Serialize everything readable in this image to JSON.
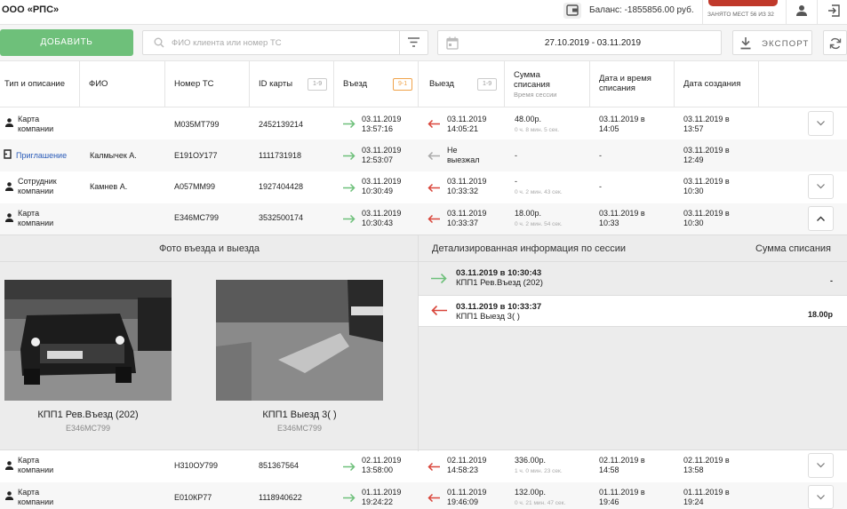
{
  "header": {
    "company": "ООО «РПС»",
    "balance": "Баланс: -1855856.00 руб.",
    "places": "ЗАНЯТО МЕСТ 56 ИЗ 32"
  },
  "toolbar": {
    "add_label": "ДОБАВИТЬ",
    "search_placeholder": "ФИО клиента или номер ТС",
    "date_range": "27.10.2019 - 03.11.2019",
    "export_label": "ЭКСПОРТ"
  },
  "columns": {
    "type": "Тип и описание",
    "name": "ФИО",
    "plate": "Номер ТС",
    "card": "ID карты",
    "card_sort": "1-9",
    "entry": "Въезд",
    "entry_sort": "9-1",
    "exit": "Выезд",
    "exit_sort": "1-9",
    "sum_l1": "Сумма",
    "sum_l2": "списания",
    "sum_sub": "Время сессии",
    "charged_l1": "Дата и время",
    "charged_l2": "списания",
    "created": "Дата создания"
  },
  "rows": [
    {
      "type_l1": "Карта",
      "type_l2": "компании",
      "name": "",
      "plate": "М035МТ799",
      "card": "2452139214",
      "entry_d": "03.11.2019",
      "entry_t": "13:57:16",
      "exit_d": "03.11.2019",
      "exit_t": "14:05:21",
      "sum": "48.00р.",
      "dur": "0 ч. 8 мин. 5 сек.",
      "charged_d": "03.11.2019 в",
      "charged_t": "14:05",
      "created_d": "03.11.2019 в",
      "created_t": "13:57"
    },
    {
      "type_l1": "Приглашение",
      "type_l2": "",
      "name": "Калмычек А.",
      "plate": "Е191ОУ177",
      "card": "1111731918",
      "entry_d": "03.11.2019",
      "entry_t": "12:53:07",
      "exit_d": "Не",
      "exit_t": "выезжал",
      "sum": "-",
      "dur": "",
      "charged_d": "-",
      "charged_t": "",
      "created_d": "03.11.2019 в",
      "created_t": "12:49"
    },
    {
      "type_l1": "Сотрудник",
      "type_l2": "компании",
      "name": "Камнев А.",
      "plate": "А057ММ99",
      "card": "1927404428",
      "entry_d": "03.11.2019",
      "entry_t": "10:30:49",
      "exit_d": "03.11.2019",
      "exit_t": "10:33:32",
      "sum": "-",
      "dur": "0 ч. 2 мин. 43 сек.",
      "charged_d": "-",
      "charged_t": "",
      "created_d": "03.11.2019 в",
      "created_t": "10:30"
    },
    {
      "type_l1": "Карта",
      "type_l2": "компании",
      "name": "",
      "plate": "Е346МС799",
      "card": "3532500174",
      "entry_d": "03.11.2019",
      "entry_t": "10:30:43",
      "exit_d": "03.11.2019",
      "exit_t": "10:33:37",
      "sum": "18.00р.",
      "dur": "0 ч. 2 мин. 54 сек.",
      "charged_d": "03.11.2019 в",
      "charged_t": "10:33",
      "created_d": "03.11.2019 в",
      "created_t": "10:30"
    },
    {
      "type_l1": "Карта",
      "type_l2": "компании",
      "name": "",
      "plate": "Н310ОУ799",
      "card": "851367564",
      "entry_d": "02.11.2019",
      "entry_t": "13:58:00",
      "exit_d": "02.11.2019",
      "exit_t": "14:58:23",
      "sum": "336.00р.",
      "dur": "1 ч. 0 мин. 23 сек.",
      "charged_d": "02.11.2019 в",
      "charged_t": "14:58",
      "created_d": "02.11.2019 в",
      "created_t": "13:58"
    },
    {
      "type_l1": "Карта",
      "type_l2": "компании",
      "name": "",
      "plate": "Е010КР77",
      "card": "1118940622",
      "entry_d": "01.11.2019",
      "entry_t": "19:24:22",
      "exit_d": "01.11.2019",
      "exit_t": "19:46:09",
      "sum": "132.00р.",
      "dur": "0 ч. 21 мин. 47 сек.",
      "charged_d": "01.11.2019 в",
      "charged_t": "19:46",
      "created_d": "01.11.2019 в",
      "created_t": "19:24"
    }
  ],
  "details": {
    "photos_title": "Фото въезда и выезда",
    "entry_caption": "КПП1 Рев.Въезд (202)",
    "entry_plate": "Е346МС799",
    "exit_caption": "КПП1 Выезд 3( )",
    "exit_plate": "Е346МС799",
    "info_title": "Детализированная информация по сессии",
    "sum_title": "Сумма списания",
    "events": [
      {
        "dt": "03.11.2019 в 10:30:43",
        "place": "КПП1 Рев.Въезд (202)",
        "amount": "-"
      },
      {
        "dt": "03.11.2019 в 10:33:37",
        "place": "КПП1 Выезд 3( )",
        "amount": "18.00р"
      }
    ]
  },
  "colors": {
    "green": "#6ec07a",
    "red": "#d9463b",
    "accent_red": "#c0392b",
    "link": "#2a5bb8"
  }
}
